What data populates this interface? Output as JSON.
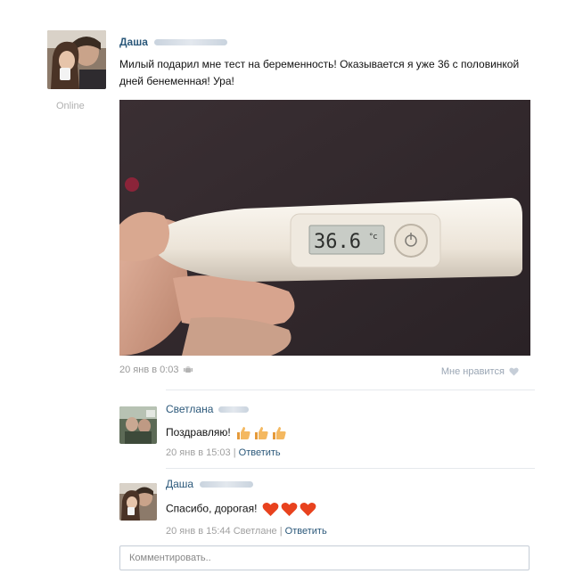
{
  "post": {
    "author_name": "Даша",
    "status": "Online",
    "text": "Милый подарил мне тест на беременность! Оказывается я уже 36 с половинкой дней бенеменная! Ура!",
    "date": "20 янв в 0:03",
    "like_label": "Мне нравится",
    "photo": {
      "thermometer_reading": "36.6",
      "thermometer_unit": "°c"
    }
  },
  "comments": [
    {
      "author_name": "Светлана",
      "text": "Поздравляю!",
      "emoji": "thumbs-up-icon",
      "emoji_count": 3,
      "date": "20 янв в 15:03",
      "reply_to": "",
      "reply_label": "Ответить"
    },
    {
      "author_name": "Даша",
      "text": "Спасибо, дорогая!",
      "emoji": "heart-icon",
      "emoji_count": 3,
      "date": "20 янв в 15:44",
      "reply_to": "Светлане",
      "reply_label": "Ответить"
    }
  ],
  "comment_input": {
    "placeholder": "Комментировать.."
  },
  "colors": {
    "link": "#2b587a",
    "meta": "#999999",
    "heart": "#e8421e",
    "thumbs": "#f0a94a"
  }
}
